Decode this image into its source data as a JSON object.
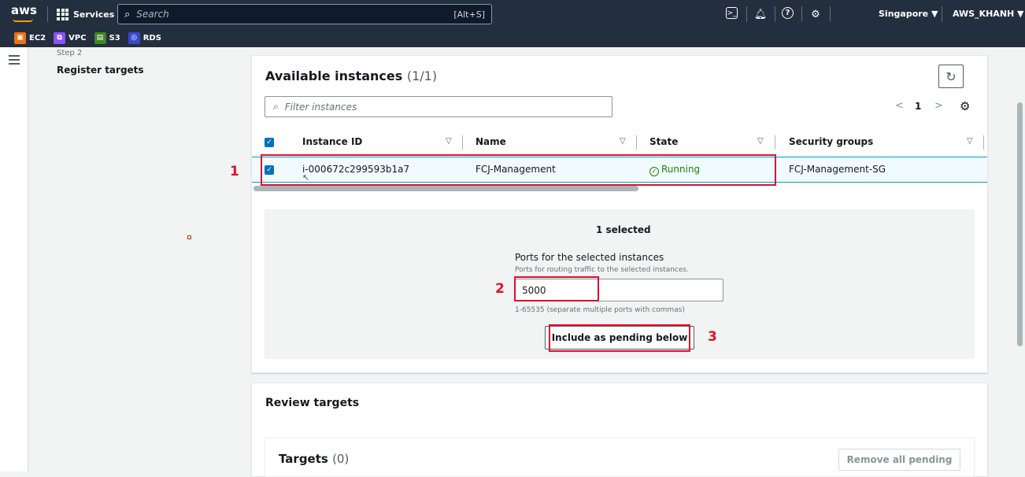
{
  "topnav": {
    "logo": "aws",
    "services_label": "Services",
    "search_placeholder": "Search",
    "search_shortcut": "[Alt+S]",
    "region": "Singapore ▼",
    "account": "AWS_KHANH ▼"
  },
  "favorites": [
    {
      "label": "EC2",
      "color": "#ec7211",
      "icon": "ec2-icon"
    },
    {
      "label": "VPC",
      "color": "#8c4fff",
      "icon": "vpc-icon"
    },
    {
      "label": "S3",
      "color": "#3f8624",
      "icon": "s3-icon"
    },
    {
      "label": "RDS",
      "color": "#3b48cc",
      "icon": "rds-icon"
    }
  ],
  "wizard": {
    "step_label": "Step 2",
    "step_title": "Register targets"
  },
  "available": {
    "title": "Available instances",
    "count": "(1/1)",
    "filter_placeholder": "Filter instances",
    "page_prev": "<",
    "page_number": "1",
    "page_next": ">",
    "columns": [
      "Instance ID",
      "Name",
      "State",
      "Security groups"
    ],
    "rows": [
      {
        "instance_id": "i-000672c299593b1a7",
        "name": "FCJ-Management",
        "state": "Running",
        "security_group": "FCJ-Management-SG",
        "selected": true
      }
    ]
  },
  "selection": {
    "summary": "1 selected",
    "ports_label": "Ports for the selected instances",
    "ports_description": "Ports for routing traffic to the selected instances.",
    "ports_value": "5000",
    "ports_hint": "1-65535 (separate multiple ports with commas)",
    "include_button": "Include as pending below"
  },
  "review": {
    "title": "Review targets",
    "targets_title": "Targets",
    "targets_count": "(0)",
    "remove_button": "Remove all pending"
  },
  "annotations": [
    "1",
    "2",
    "3"
  ],
  "colors": {
    "nav_bg": "#232f3e",
    "accent_blue": "#0073bb",
    "running_green": "#1d8102",
    "annotation_red": "#e0102e"
  }
}
